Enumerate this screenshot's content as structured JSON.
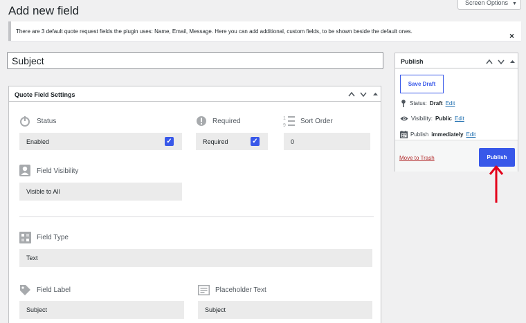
{
  "page": {
    "title": "Add new field"
  },
  "screen_options": {
    "label": "Screen Options"
  },
  "notice": {
    "text": "There are 3 default quote request fields the plugin uses: Name, Email, Message. Here you can add additional, custom fields, to be shown beside the default ones.",
    "dismiss": "×"
  },
  "title_field": {
    "value": "Subject"
  },
  "settings": {
    "heading": "Quote Field Settings",
    "status": {
      "label": "Status",
      "value": "Enabled",
      "checked": true
    },
    "required": {
      "label": "Required",
      "value": "Required",
      "checked": true
    },
    "sort_order": {
      "label": "Sort Order",
      "value": "0"
    },
    "visibility": {
      "label": "Field Visibility",
      "value": "Visible to All"
    },
    "field_type": {
      "label": "Field Type",
      "value": "Text"
    },
    "field_label": {
      "label": "Field Label",
      "value": "Subject"
    },
    "placeholder": {
      "label": "Placeholder Text",
      "value": "Subject"
    }
  },
  "publish_box": {
    "heading": "Publish",
    "save_draft": "Save Draft",
    "status_label": "Status:",
    "status_value": "Draft",
    "visibility_label": "Visibility:",
    "visibility_value": "Public",
    "schedule_label": "Publish",
    "schedule_value": "immediately",
    "edit": "Edit",
    "trash": "Move to Trash",
    "publish": "Publish"
  },
  "colors": {
    "accent": "#3858e9",
    "annotation_arrow": "#e3001b",
    "trash": "#b32d2e"
  }
}
